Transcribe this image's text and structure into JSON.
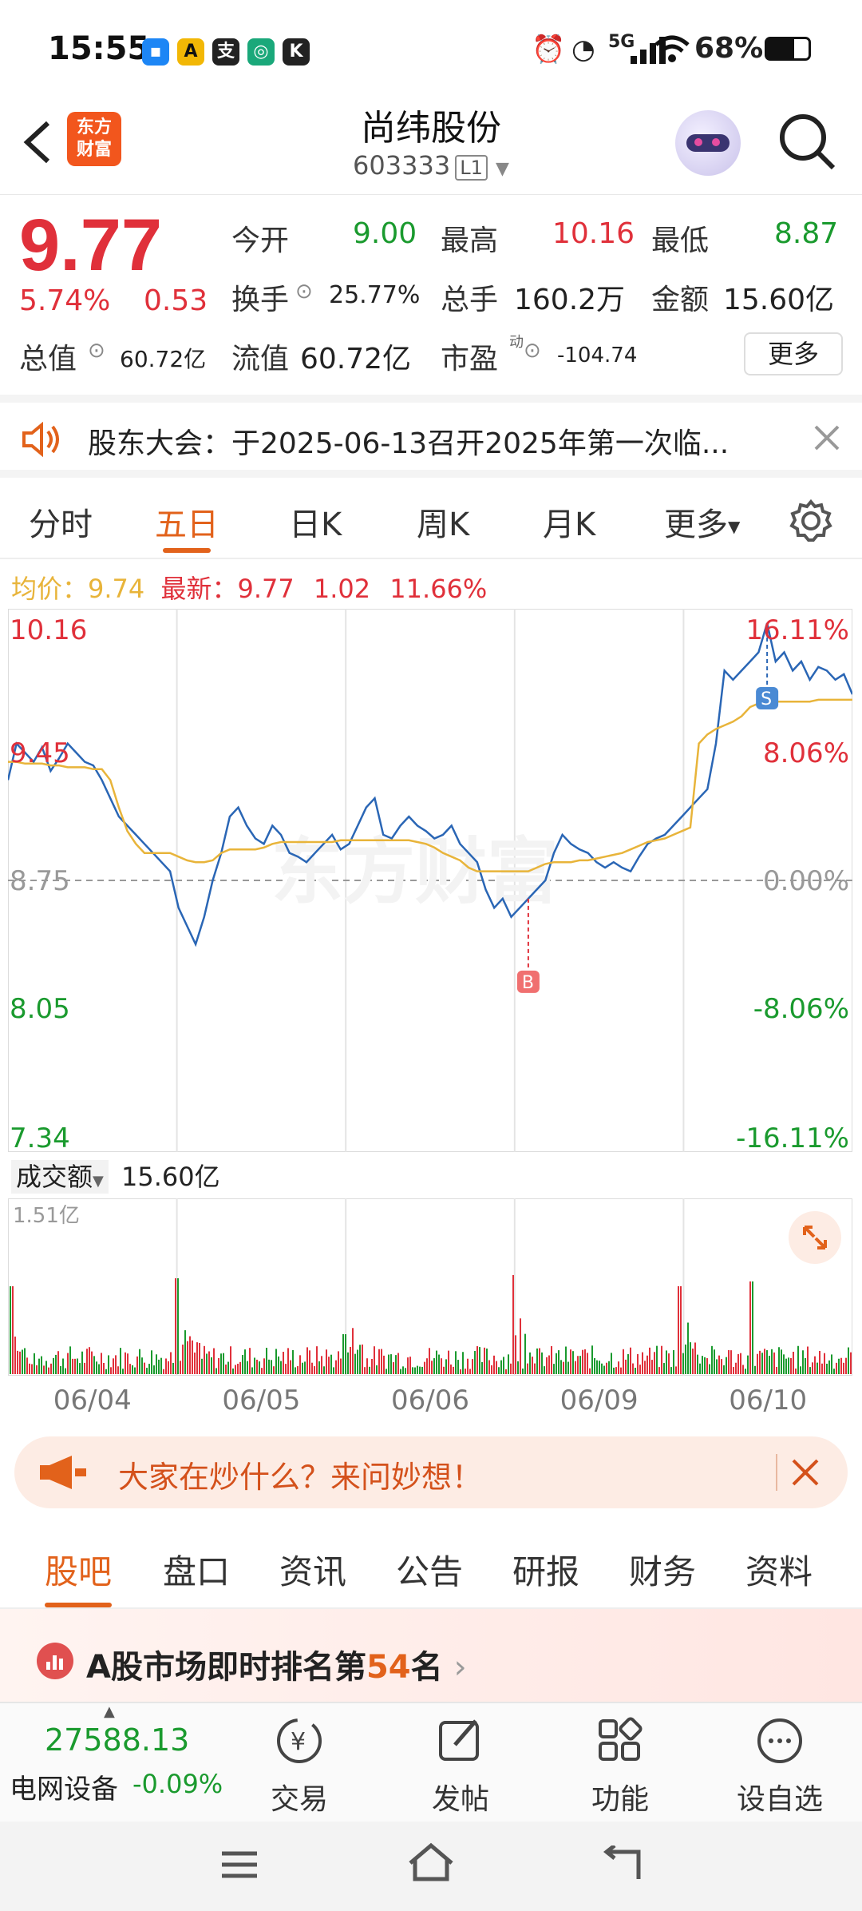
{
  "status_bar": {
    "time": "15:55",
    "network": "5G",
    "battery": "68%"
  },
  "header": {
    "stock_name": "尚纬股份",
    "stock_code": "603333",
    "level_tag": "L1",
    "logo_text": "东方财富"
  },
  "quote": {
    "price": "9.77",
    "change_pct": "5.74%",
    "change_abs": "0.53",
    "open_label": "今开",
    "open": "9.00",
    "high_label": "最高",
    "high": "10.16",
    "low_label": "最低",
    "low": "8.87",
    "turnover_rate_label": "换手",
    "turnover_rate": "25.77%",
    "volume_label": "总手",
    "volume": "160.2万",
    "amount_label": "金额",
    "amount": "15.60亿",
    "total_value_label": "总值",
    "total_value": "60.72亿",
    "float_value_label": "流值",
    "float_value": "60.72亿",
    "pe_label": "市盈",
    "pe_sup": "动",
    "pe": "-104.74",
    "more_label": "更多"
  },
  "notice": {
    "text": "股东大会：于2025-06-13召开2025年第一次临..."
  },
  "chart_tabs": [
    "分时",
    "五日",
    "日K",
    "周K",
    "月K",
    "更多"
  ],
  "chart_info": {
    "avg_label": "均价：",
    "avg": "9.74",
    "latest_label": "最新：",
    "latest": "9.77",
    "latest_change": "1.02",
    "latest_pct": "11.66%"
  },
  "chart_data": {
    "type": "line",
    "title": "",
    "x": [
      "06/04",
      "06/05",
      "06/06",
      "06/09",
      "06/10"
    ],
    "y_left_ticks": [
      "10.16",
      "9.45",
      "8.75",
      "8.05",
      "7.34"
    ],
    "y_right_ticks": [
      "16.11%",
      "8.06%",
      "0.00%",
      "-8.06%",
      "-16.11%"
    ],
    "ylim": [
      7.34,
      10.16
    ],
    "baseline": 8.75,
    "series": [
      {
        "values": [
          9.3,
          9.5,
          9.45,
          9.4,
          9.48,
          9.35,
          9.42,
          9.5,
          9.45,
          9.4,
          9.38,
          9.3,
          9.2,
          9.1,
          9.05,
          9.0,
          8.95,
          8.9,
          8.85,
          8.8,
          8.6,
          8.5,
          8.4,
          8.55,
          8.75,
          8.9,
          9.1,
          9.15,
          9.05,
          8.98,
          8.95,
          9.05,
          9.0,
          8.9,
          8.88,
          8.85,
          8.9,
          8.95,
          9.0,
          8.92,
          8.95,
          9.05,
          9.15,
          9.2,
          9.0,
          8.98,
          9.05,
          9.1,
          9.05,
          9.02,
          8.98,
          9.0,
          9.05,
          8.95,
          8.9,
          8.85,
          8.7,
          8.6,
          8.65,
          8.55,
          8.6,
          8.65,
          8.7,
          8.75,
          8.9,
          9.0,
          8.95,
          8.92,
          8.9,
          8.85,
          8.82,
          8.85,
          8.82,
          8.8,
          8.88,
          8.95,
          8.98,
          9.0,
          9.05,
          9.1,
          9.15,
          9.2,
          9.25,
          9.5,
          9.9,
          9.85,
          9.9,
          9.95,
          10.0,
          10.16,
          9.95,
          10.0,
          9.9,
          9.95,
          9.85,
          9.92,
          9.9,
          9.85,
          9.88,
          9.77
        ]
      },
      {
        "values": [
          9.4,
          9.4,
          9.39,
          9.39,
          9.39,
          9.38,
          9.38,
          9.37,
          9.37,
          9.37,
          9.36,
          9.36,
          9.3,
          9.15,
          9.02,
          8.95,
          8.9,
          8.9,
          8.9,
          8.9,
          8.88,
          8.86,
          8.85,
          8.85,
          8.86,
          8.9,
          8.92,
          8.92,
          8.92,
          8.92,
          8.93,
          8.95,
          8.96,
          8.96,
          8.96,
          8.96,
          8.96,
          8.96,
          8.96,
          8.97,
          8.97,
          8.97,
          8.97,
          8.97,
          8.97,
          8.97,
          8.97,
          8.97,
          8.96,
          8.95,
          8.93,
          8.9,
          8.88,
          8.86,
          8.82,
          8.8,
          8.8,
          8.8,
          8.8,
          8.8,
          8.8,
          8.8,
          8.82,
          8.84,
          8.85,
          8.85,
          8.85,
          8.86,
          8.86,
          8.87,
          8.88,
          8.89,
          8.9,
          8.92,
          8.94,
          8.96,
          8.97,
          8.98,
          9.0,
          9.02,
          9.04,
          9.5,
          9.55,
          9.58,
          9.6,
          9.62,
          9.65,
          9.7,
          9.72,
          9.72,
          9.73,
          9.73,
          9.73,
          9.73,
          9.73,
          9.74,
          9.74,
          9.74,
          9.74,
          9.74
        ]
      }
    ],
    "markers": [
      {
        "label": "B"
      },
      {
        "label": "S"
      }
    ],
    "volume_label": "成交额",
    "volume_total": "15.60亿",
    "volume_max": "1.51亿"
  },
  "banner": {
    "text": "大家在炒什么？来问妙想！"
  },
  "info_tabs": [
    "股吧",
    "盘口",
    "资讯",
    "公告",
    "研报",
    "财务",
    "资料"
  ],
  "rank": {
    "prefix": "A股市场即时排名第",
    "rank": "54",
    "suffix": "名"
  },
  "bottom_bar": {
    "index_value": "27588.13",
    "index_name": "电网设备",
    "index_change": "-0.09%",
    "items": [
      "交易",
      "发帖",
      "功能",
      "设自选"
    ]
  },
  "colors": {
    "up": "#e0303a",
    "down": "#1a9a2e",
    "accent": "#e2621b",
    "line": "#2a66b5",
    "avg": "#e8b43a"
  }
}
